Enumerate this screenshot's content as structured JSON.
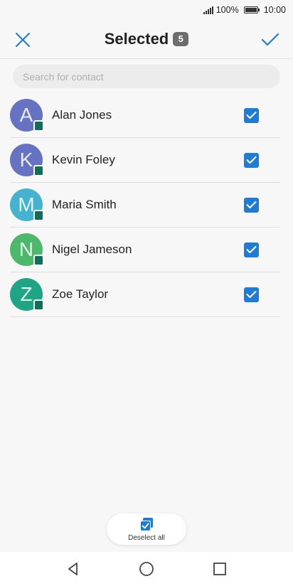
{
  "status_bar": {
    "battery_percent": "100%",
    "time": "10:00"
  },
  "toolbar": {
    "title": "Selected",
    "count": "5"
  },
  "search": {
    "placeholder": "Search for contact",
    "value": ""
  },
  "contacts": [
    {
      "initial": "A",
      "name": "Alan Jones",
      "color": "#6672c2",
      "checked": true
    },
    {
      "initial": "K",
      "name": "Kevin Foley",
      "color": "#6672c2",
      "checked": true
    },
    {
      "initial": "M",
      "name": "Maria Smith",
      "color": "#45b2d0",
      "checked": true
    },
    {
      "initial": "N",
      "name": "Nigel Jameson",
      "color": "#4cb86c",
      "checked": true
    },
    {
      "initial": "Z",
      "name": "Zoe Taylor",
      "color": "#1fa585",
      "checked": true
    }
  ],
  "deselect_all": {
    "label": "Deselect all"
  },
  "colors": {
    "accent": "#1e7bd6",
    "sim_badge": "#0f6f5a"
  },
  "icons": {
    "close": "close-icon",
    "confirm": "check-icon",
    "deselect": "checkbox-multiple-icon",
    "back": "back-triangle-icon",
    "home": "home-circle-icon",
    "recents": "recents-square-icon"
  }
}
